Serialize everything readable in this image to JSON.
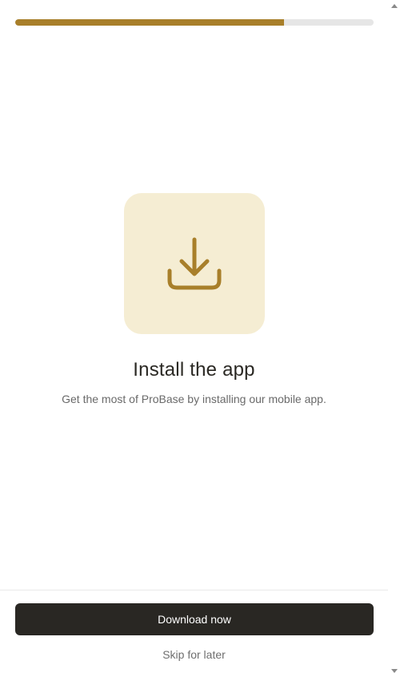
{
  "progress": {
    "value_percent": 75,
    "fill_color": "#a87f2a",
    "track_color": "#e6e6e6"
  },
  "hero": {
    "icon": "download-icon",
    "tile_color": "#f5edd3",
    "icon_color": "#a87f2a"
  },
  "content": {
    "title": "Install the app",
    "subtitle": "Get the most of ProBase by installing our mobile app."
  },
  "actions": {
    "primary_label": "Download now",
    "secondary_label": "Skip for later"
  },
  "scrollbar": {
    "up_icon": "scroll-up-arrow-icon",
    "down_icon": "scroll-down-arrow-icon"
  }
}
